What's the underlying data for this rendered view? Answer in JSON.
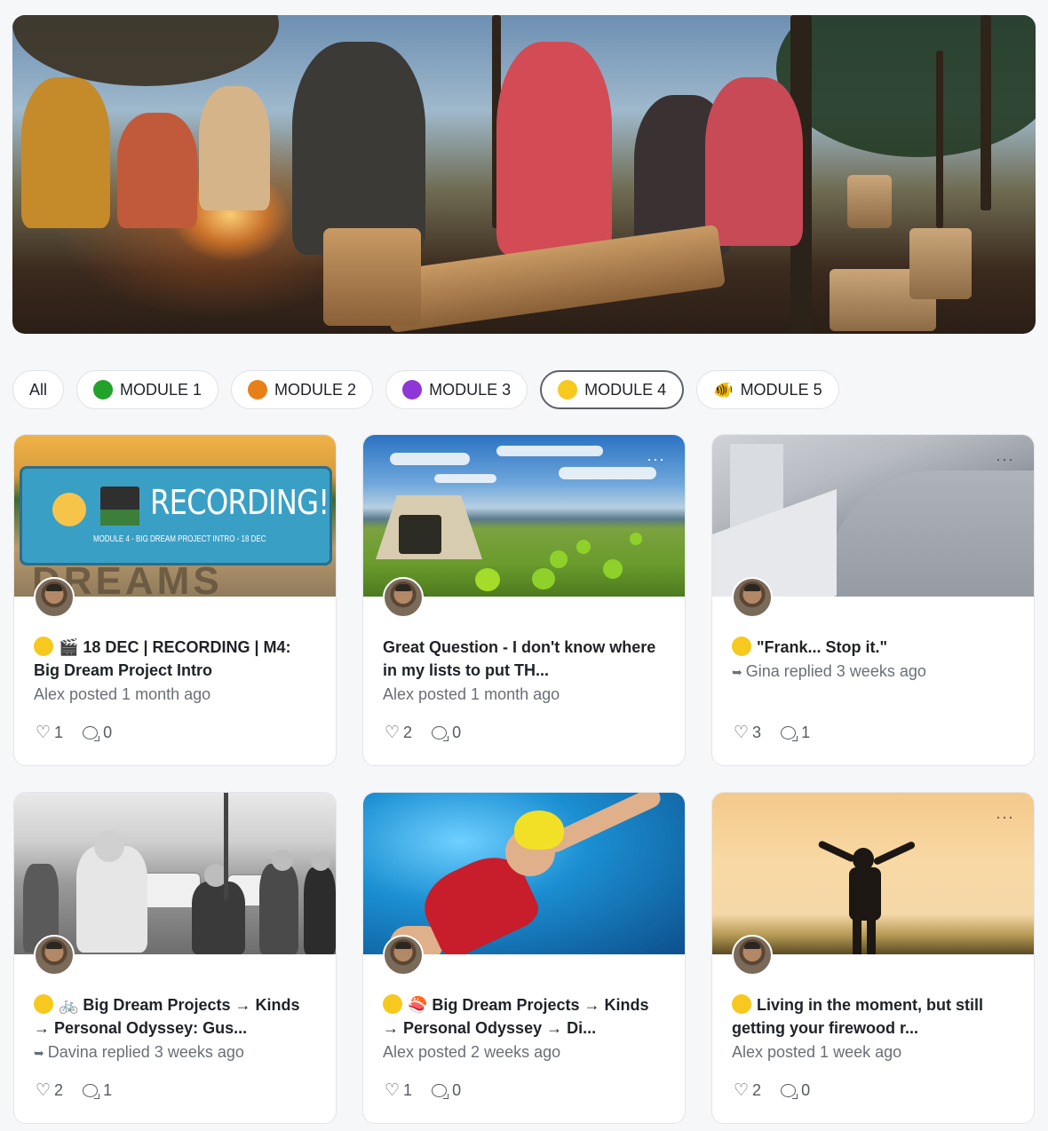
{
  "filters": [
    {
      "label": "All",
      "dot": null,
      "active": false
    },
    {
      "label": "MODULE 1",
      "dot": "#22a22b",
      "active": false
    },
    {
      "label": "MODULE 2",
      "dot": "#e8801a",
      "active": false
    },
    {
      "label": "MODULE 3",
      "dot": "#8e36d6",
      "active": false
    },
    {
      "label": "MODULE 4",
      "dot": "#f7c81e",
      "active": true
    },
    {
      "label": "MODULE 5",
      "dot": "fish",
      "active": false
    }
  ],
  "cards": [
    {
      "thumb_text_big": "RECORDING!",
      "thumb_text_small": "MODULE 4 - BIG DREAM PROJECT INTRO - 18 DEC",
      "title": "🎬 18 DEC | RECORDING | M4: Big Dream Project Intro",
      "meta": "Alex posted 1 month ago",
      "likes": "1",
      "comments": "0"
    },
    {
      "title": "Great Question - I don't know where in my lists to put TH...",
      "meta": "Alex posted 1 month ago",
      "likes": "2",
      "comments": "0"
    },
    {
      "title": "\"Frank... Stop it.\"",
      "meta": "Gina replied 3 weeks ago",
      "likes": "3",
      "comments": "1"
    },
    {
      "title": "🚲 Big Dream Projects → Kinds → Personal Odyssey: Gus...",
      "meta": "Davina replied 3 weeks ago",
      "likes": "2",
      "comments": "1"
    },
    {
      "title": "🍣 Big Dream Projects → Kinds → Personal Odyssey → Di...",
      "meta": "Alex posted 2 weeks ago",
      "likes": "1",
      "comments": "0"
    },
    {
      "title": "Living in the moment, but still getting your firewood r...",
      "meta": "Alex posted 1 week ago",
      "likes": "2",
      "comments": "0"
    }
  ],
  "colors": {
    "accent_yellow": "#f7c81e",
    "border": "#e2e5e9",
    "muted_text": "#6a6f76"
  }
}
